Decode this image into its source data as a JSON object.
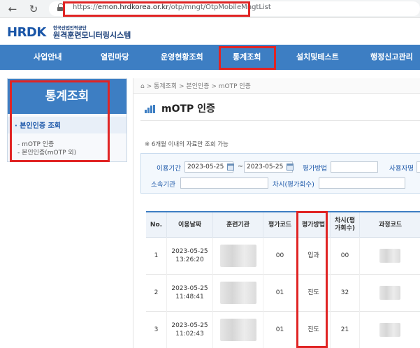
{
  "browser": {
    "url_scheme": "https://",
    "url_host": "emon.hrdkorea.or.kr",
    "url_path": "/otp/mngt/OtpMobileMngtList"
  },
  "logo": {
    "mark": "HRDK",
    "org_small": "한국산업인력공단",
    "system_name": "원격훈련모니터링시스템"
  },
  "topnav": {
    "items": [
      "사업안내",
      "열린마당",
      "운영현황조회",
      "통계조회",
      "설치및테스트",
      "행정신고관리"
    ]
  },
  "sidebar": {
    "title": "통계조회",
    "active_item": "본인인증 조회",
    "sub_items": [
      "mOTP 인증",
      "본인인증(mOTP 외)"
    ]
  },
  "breadcrumb": "⌂ > 통계조회 > 본인인증 > mOTP 인증",
  "page_title": "mOTP 인증",
  "notice": "※ 6개월 이내의 자료만 조회 가능",
  "search": {
    "date_label": "이용기간",
    "date_from": "2023-05-25",
    "date_sep": "~",
    "date_to": "2023-05-25",
    "method_label": "평가방법",
    "method_value": "",
    "user_label": "사용자명",
    "org_label": "소속기관",
    "org_value": "",
    "session_label": "차시(평가회수)",
    "session_value": ""
  },
  "table": {
    "headers": [
      "No.",
      "이용날짜",
      "훈련기관",
      "평가코드",
      "평가방법",
      "차시(평\n가회수)",
      "과정코드"
    ],
    "rows": [
      {
        "no": "1",
        "date": "2023-05-25",
        "time": "13:26:20",
        "code": "00",
        "method": "입과",
        "session": "00"
      },
      {
        "no": "2",
        "date": "2023-05-25",
        "time": "11:48:41",
        "code": "01",
        "method": "진도",
        "session": "32"
      },
      {
        "no": "3",
        "date": "2023-05-25",
        "time": "11:02:43",
        "code": "01",
        "method": "진도",
        "session": "21"
      }
    ]
  }
}
